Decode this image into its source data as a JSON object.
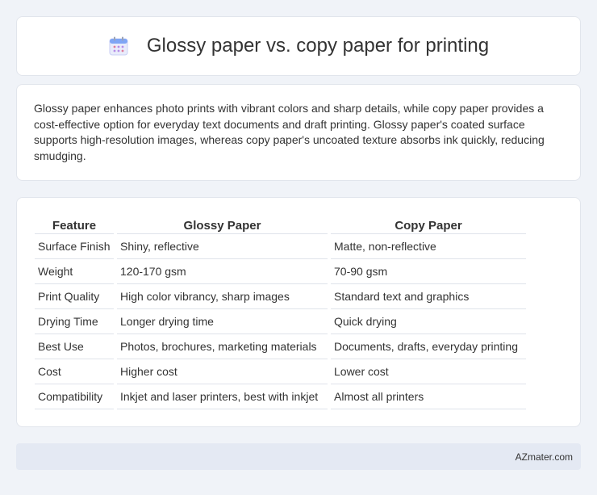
{
  "header": {
    "title": "Glossy paper vs. copy paper for printing",
    "icon": "calendar-icon"
  },
  "summary": {
    "text": "Glossy paper enhances photo prints with vibrant colors and sharp details, while copy paper provides a cost-effective option for everyday text documents and draft printing. Glossy paper's coated surface supports high-resolution images, whereas copy paper's uncoated texture absorbs ink quickly, reducing smudging."
  },
  "table": {
    "headers": [
      "Feature",
      "Glossy Paper",
      "Copy Paper"
    ],
    "rows": [
      [
        "Surface Finish",
        "Shiny, reflective",
        "Matte, non-reflective"
      ],
      [
        "Weight",
        "120-170 gsm",
        "70-90 gsm"
      ],
      [
        "Print Quality",
        "High color vibrancy, sharp images",
        "Standard text and graphics"
      ],
      [
        "Drying Time",
        "Longer drying time",
        "Quick drying"
      ],
      [
        "Best Use",
        "Photos, brochures, marketing materials",
        "Documents, drafts, everyday printing"
      ],
      [
        "Cost",
        "Higher cost",
        "Lower cost"
      ],
      [
        "Compatibility",
        "Inkjet and laser printers, best with inkjet",
        "Almost all printers"
      ]
    ]
  },
  "footer": {
    "brand": "AZmater.com"
  },
  "colors": {
    "page_background": "#f0f3f8",
    "card_background": "#ffffff",
    "footer_background": "#e4e9f3",
    "icon_accent": "#7a8cf0"
  }
}
